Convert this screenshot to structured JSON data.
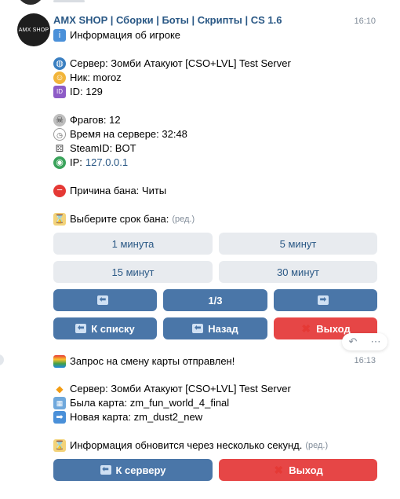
{
  "header": {
    "title": "AMX SHOP | Сборки | Боты | Скрипты | CS 1.6",
    "avatar_text": "AMX SHOP",
    "time": "16:10"
  },
  "msg1": {
    "info_title": "Информация об игроке",
    "server": "Сервер: Зомби Атакуют [CSO+LVL] Test Server",
    "nick": "Ник: moroz",
    "id": "ID: 129",
    "frags": "Фрагов: 12",
    "time_on_server": "Время на сервере: 32:48",
    "steamid": "SteamID: BOT",
    "ip_label": "IP: ",
    "ip_value": "127.0.0.1",
    "ban_reason": "Причина бана: Читы",
    "choose_ban": "Выберите срок бана:",
    "edited": "(ред.)"
  },
  "keyboard1": {
    "btn_1min": "1 минута",
    "btn_5min": "5 минут",
    "btn_15min": "15 минут",
    "btn_30min": "30 минут",
    "prev_icon": "⬅",
    "page": "1/3",
    "next_icon": "➡",
    "to_list": "К списку",
    "back": "Назад",
    "exit": "Выход"
  },
  "msg2": {
    "time": "16:13",
    "request": "Запрос на смену карты отправлен!",
    "server": "Сервер: Зомби Атакуют [CSO+LVL] Test Server",
    "old_map": "Была карта: zm_fun_world_4_final",
    "new_map": "Новая карта: zm_dust2_new",
    "update_info": "Информация обновится через несколько секунд.",
    "edited": "(ред.)"
  },
  "keyboard2": {
    "to_server": "К серверу",
    "exit": "Выход"
  },
  "hover_actions": {
    "reply_icon": "reply-icon",
    "more_icon": "more-icon"
  }
}
